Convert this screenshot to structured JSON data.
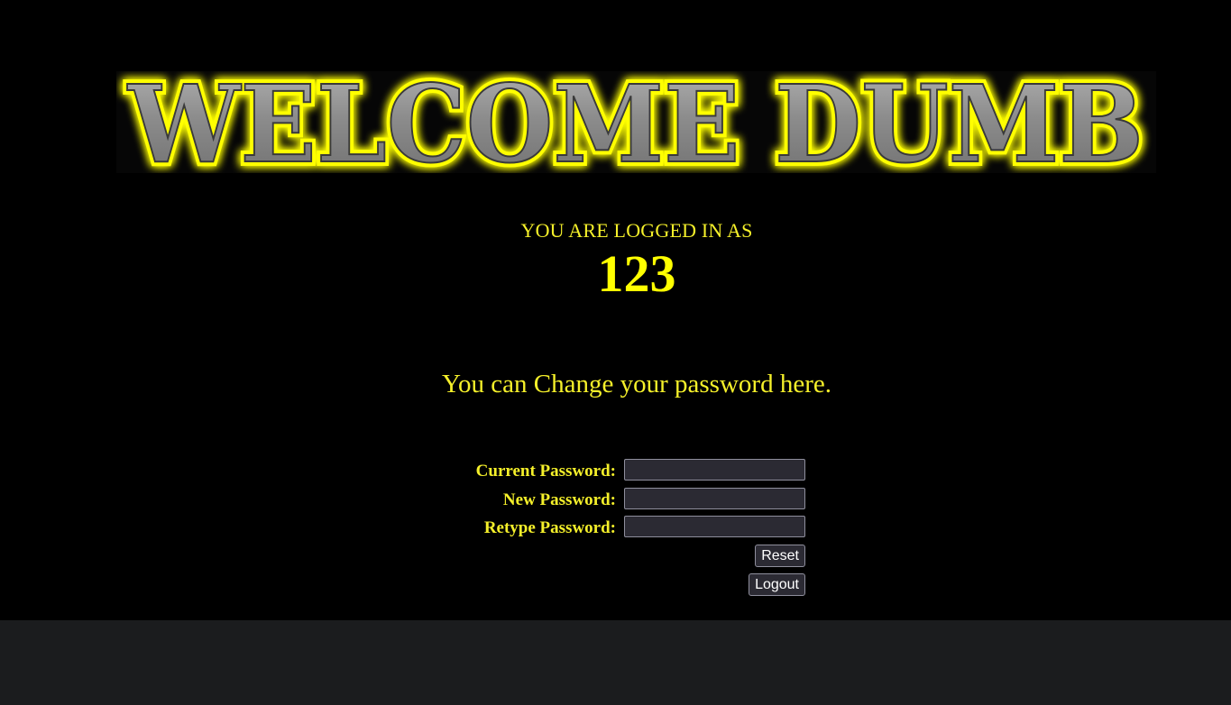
{
  "banner": {
    "text": "WELCOME DUMB",
    "glow_color": "#ffff00",
    "metal_color": "#8e8e8e"
  },
  "session": {
    "logged_in_label": "YOU ARE LOGGED IN AS",
    "username": "123"
  },
  "message": "You can Change your password here.",
  "form": {
    "current_label": "Current Password:",
    "new_label": "New Password:",
    "retype_label": "Retype Password:",
    "current_value": "",
    "new_value": "",
    "retype_value": "",
    "reset_label": "Reset",
    "logout_label": "Logout"
  },
  "colors": {
    "background": "#000000",
    "footer": "#1b1c1e",
    "text": "#f5f02a",
    "input_bg": "#2b2a33"
  }
}
